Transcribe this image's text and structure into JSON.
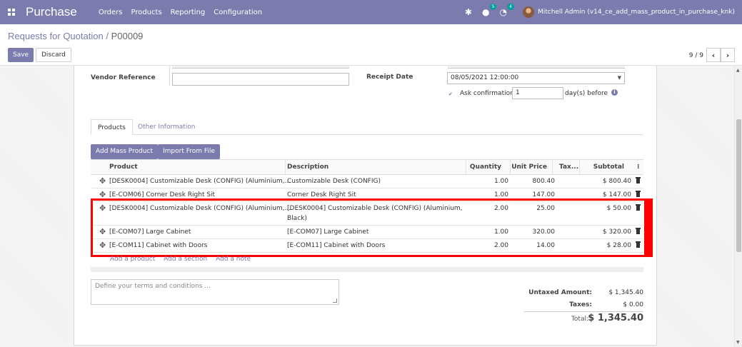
{
  "navbar": {
    "app_name": "Purchase",
    "menu": [
      "Orders",
      "Products",
      "Reporting",
      "Configuration"
    ],
    "chat_count": "5",
    "activity_count": "4",
    "user": "Mitchell Admin (v14_ce_add_mass_product_in_purchase_knk)"
  },
  "breadcrumb": {
    "parent": "Requests for Quotation",
    "separator": "/",
    "current": "P00009"
  },
  "actions": {
    "save": "Save",
    "discard": "Discard"
  },
  "pager": {
    "value": "9 / 9"
  },
  "form": {
    "vendor_reference_label": "Vendor Reference",
    "vendor_reference_value": "",
    "receipt_date_label": "Receipt Date",
    "receipt_date_value": "08/05/2021 12:00:00",
    "ask_confirmation_label": "Ask confirmation",
    "ask_confirmation_days": "1",
    "days_before_label": "day(s) before"
  },
  "tabs": [
    "Products",
    "Other Information"
  ],
  "buttons": {
    "add_mass_product": "Add Mass Product",
    "import_from_file": "Import From File"
  },
  "table": {
    "headers": {
      "product": "Product",
      "description": "Description",
      "quantity": "Quantity",
      "unit_price": "Unit Price",
      "taxes": "Tax...",
      "subtotal": "Subtotal"
    },
    "rows": [
      {
        "product": "[DESK0004] Customizable Desk (CONFIG) (Aluminium,...",
        "description": "Customizable Desk (CONFIG)",
        "description2": "",
        "quantity": "1.00",
        "unit_price": "800.40",
        "subtotal": "$ 800.40"
      },
      {
        "product": "[E-COM06] Corner Desk Right Sit",
        "description": "Corner Desk Right Sit",
        "description2": "",
        "quantity": "1.00",
        "unit_price": "147.00",
        "subtotal": "$ 147.00"
      },
      {
        "product": "[DESK0004] Customizable Desk (CONFIG) (Aluminium,...",
        "description": "[DESK0004] Customizable Desk (CONFIG) (Aluminium,",
        "description2": "Black)",
        "quantity": "2.00",
        "unit_price": "25.00",
        "subtotal": "$ 50.00"
      },
      {
        "product": "[E-COM07] Large Cabinet",
        "description": "[E-COM07] Large Cabinet",
        "description2": "",
        "quantity": "1.00",
        "unit_price": "320.00",
        "subtotal": "$ 320.00"
      },
      {
        "product": "[E-COM11] Cabinet with Doors",
        "description": "[E-COM11] Cabinet with Doors",
        "description2": "",
        "quantity": "2.00",
        "unit_price": "14.00",
        "subtotal": "$ 28.00"
      }
    ],
    "add_links": [
      "Add a product",
      "Add a section",
      "Add a note"
    ]
  },
  "terms_placeholder": "Define your terms and conditions ...",
  "totals": {
    "untaxed_label": "Untaxed Amount:",
    "untaxed_value": "$ 1,345.40",
    "taxes_label": "Taxes:",
    "taxes_value": "$ 0.00",
    "total_label": "Total:",
    "total_value": "$ 1,345.40"
  }
}
